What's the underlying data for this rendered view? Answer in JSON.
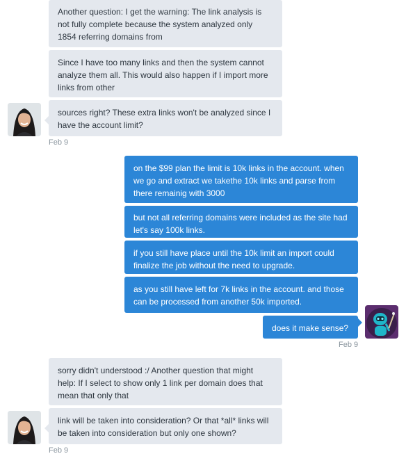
{
  "thread": {
    "group1": {
      "messages": [
        "Another question:  I get the warning: The link analysis is not fully complete because the system analyzed only 1854 referring domains from",
        "Since I have too many links and then the system cannot analyze them all. This would also happen if I import more links from other",
        "sources right? These extra links won't be analyzed since I have the account limit?"
      ],
      "timestamp": "Feb 9",
      "avatar": "woman-avatar"
    },
    "group2": {
      "messages": [
        "on the $99 plan the limit is 10k links in the account. when we go and extract we takethe 10k links and parse from there remainig with 3000",
        "but not all referring domains were included as the site had let's say 100k links.",
        "if you still have place until the 10k limit an import could finalize the job without the need to upgrade.",
        "as you still have left for 7k links in the account. and those can be processed from another 50k imported.",
        "does it make sense?"
      ],
      "timestamp": "Feb 9",
      "avatar": "robot-avatar"
    },
    "group3": {
      "messages": [
        "sorry didn't understood :/ Another question that might help: If I select to show only 1 link per domain does that mean that only that",
        "link will be taken into consideration? Or that *all* links will be taken into consideration but only one shown?"
      ],
      "timestamp": "Feb 9",
      "avatar": "woman-avatar"
    }
  },
  "colors": {
    "incoming_bubble": "#e4e8ee",
    "outgoing_bubble": "#2c86d7",
    "timestamp": "#8a959e"
  }
}
